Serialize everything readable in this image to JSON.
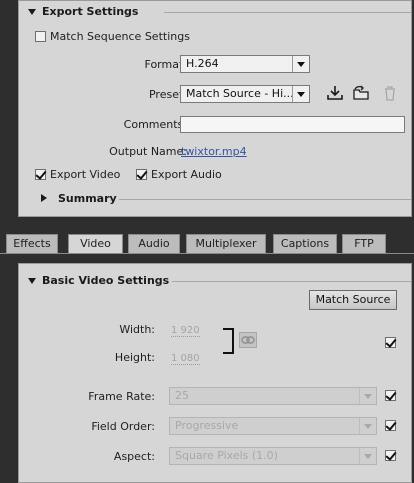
{
  "export_settings": {
    "title": "Export Settings",
    "match_sequence_label": "Match Sequence Settings",
    "match_sequence_checked": false,
    "format_label": "Format:",
    "format_value": "H.264",
    "preset_label": "Preset:",
    "preset_value": "Match Source - Hi...",
    "comments_label": "Comments:",
    "comments_value": "",
    "output_name_label": "Output Name:",
    "output_name_value": "twixtor.mp4",
    "export_video_label": "Export Video",
    "export_video_checked": true,
    "export_audio_label": "Export Audio",
    "export_audio_checked": true,
    "summary_label": "Summary"
  },
  "tabs": [
    {
      "label": "Effects",
      "active": false
    },
    {
      "label": "Video",
      "active": true
    },
    {
      "label": "Audio",
      "active": false
    },
    {
      "label": "Multiplexer",
      "active": false
    },
    {
      "label": "Captions",
      "active": false
    },
    {
      "label": "FTP",
      "active": false
    }
  ],
  "basic_video": {
    "title": "Basic Video Settings",
    "match_source_button": "Match Source",
    "width_label": "Width:",
    "width_value": "1 920",
    "height_label": "Height:",
    "height_value": "1 080",
    "frame_rate_label": "Frame Rate:",
    "frame_rate_value": "25",
    "field_order_label": "Field Order:",
    "field_order_value": "Progressive",
    "aspect_label": "Aspect:",
    "aspect_value": "Square Pixels (1.0)"
  },
  "icons": {
    "save_preset": "download-icon",
    "import_preset": "folder-arrow-icon",
    "delete_preset": "trash-icon",
    "link_dimensions": "chain-link-icon"
  }
}
